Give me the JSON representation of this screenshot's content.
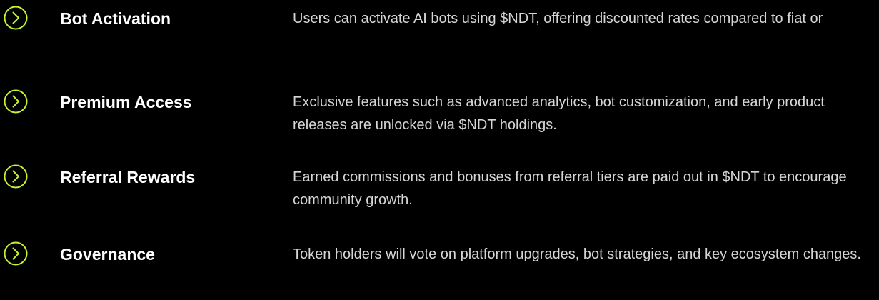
{
  "colors": {
    "background": "#000000",
    "accent": "#c6f432",
    "title": "#ffffff",
    "description": "#d6d6d6"
  },
  "features": [
    {
      "icon": "chevron-right-circle-icon",
      "title": "Bot Activation",
      "description": "Users can activate AI bots using $NDT, offering discounted rates compared to fiat or"
    },
    {
      "icon": "chevron-right-circle-icon",
      "title": "Premium Access",
      "description": "Exclusive features such as advanced analytics, bot customization, and early product releases are unlocked via $NDT holdings."
    },
    {
      "icon": "chevron-right-circle-icon",
      "title": "Referral Rewards",
      "description": "Earned commissions and bonuses from referral tiers are paid out in $NDT to encourage community growth."
    },
    {
      "icon": "chevron-right-circle-icon",
      "title": "Governance",
      "description": "Token holders will vote on platform upgrades, bot strategies, and key ecosystem changes."
    }
  ]
}
